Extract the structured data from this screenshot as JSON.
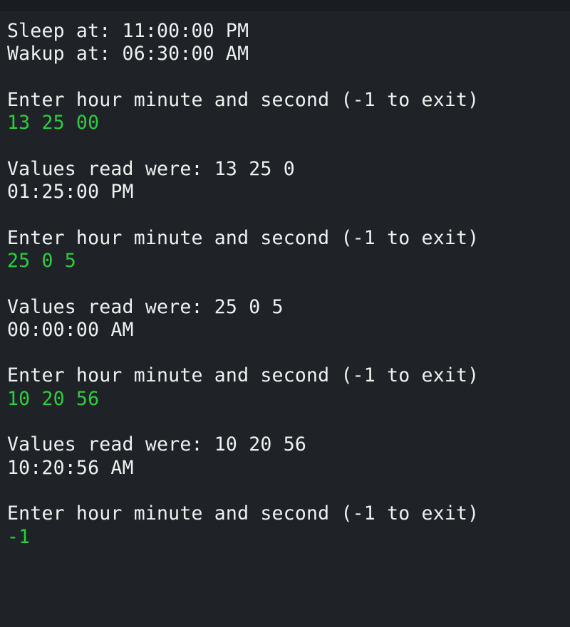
{
  "console": {
    "lines": [
      {
        "text": "Sleep at: 11:00:00 PM",
        "type": "out"
      },
      {
        "text": "Wakup at: 06:30:00 AM",
        "type": "out"
      },
      {
        "text": "",
        "type": "out"
      },
      {
        "text": "Enter hour minute and second (-1 to exit)",
        "type": "out"
      },
      {
        "text": "13 25 00",
        "type": "input"
      },
      {
        "text": "",
        "type": "out"
      },
      {
        "text": "Values read were: 13 25 0",
        "type": "out"
      },
      {
        "text": "01:25:00 PM",
        "type": "out"
      },
      {
        "text": "",
        "type": "out"
      },
      {
        "text": "Enter hour minute and second (-1 to exit)",
        "type": "out"
      },
      {
        "text": "25 0 5",
        "type": "input"
      },
      {
        "text": "",
        "type": "out"
      },
      {
        "text": "Values read were: 25 0 5",
        "type": "out"
      },
      {
        "text": "00:00:00 AM",
        "type": "out"
      },
      {
        "text": "",
        "type": "out"
      },
      {
        "text": "Enter hour minute and second (-1 to exit)",
        "type": "out"
      },
      {
        "text": "10 20 56",
        "type": "input"
      },
      {
        "text": "",
        "type": "out"
      },
      {
        "text": "Values read were: 10 20 56",
        "type": "out"
      },
      {
        "text": "10:20:56 AM",
        "type": "out"
      },
      {
        "text": "",
        "type": "out"
      },
      {
        "text": "Enter hour minute and second (-1 to exit)",
        "type": "out"
      },
      {
        "text": "-1",
        "type": "input"
      }
    ]
  },
  "colors": {
    "background": "#1f2327",
    "output_text": "#f0f0f0",
    "input_text": "#2ecc40"
  }
}
